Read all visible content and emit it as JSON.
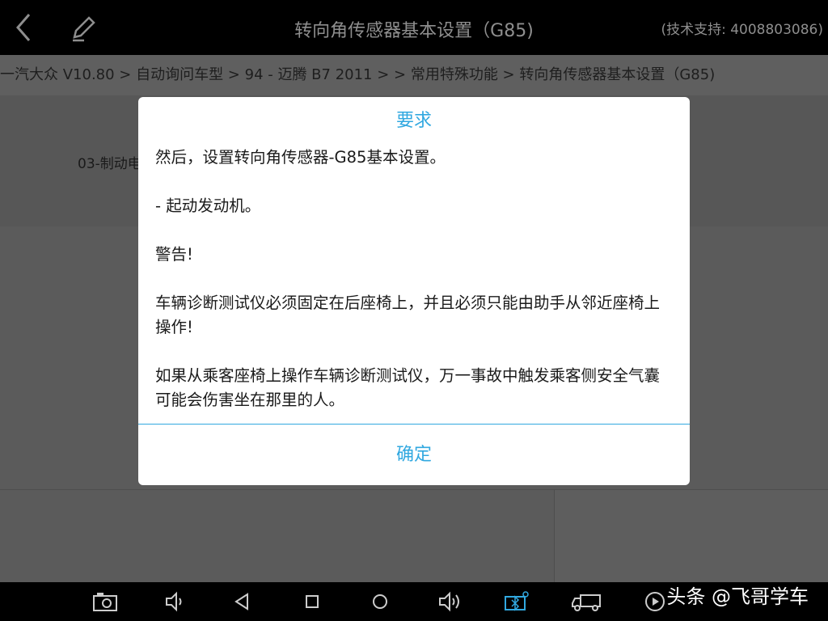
{
  "header": {
    "title": "转向角传感器基本设置（G85)",
    "support": "(技术支持: 4008803086)",
    "back_icon": "chevron-left-icon",
    "edit_icon": "pencil-icon"
  },
  "breadcrumb": "一汽大众 V10.80 > 自动询问车型 > 94 - 迈腾 B7 2011 > > 常用特殊功能 > 转向角传感器基本设置（G85)",
  "background": {
    "row_label": "03-制动电"
  },
  "dialog": {
    "title": "要求",
    "paragraphs": [
      "然后，设置转向角传感器-G85基本设置。",
      "- 起动发动机。",
      "警告!",
      "车辆诊断测试仪必须固定在后座椅上，并且必须只能由助手从邻近座椅上操作!",
      "如果从乘客座椅上操作车辆诊断测试仪，万一事故中触发乘客侧安全气囊可能会伤害坐在那里的人。"
    ],
    "ok_label": "确定",
    "accent_color": "#31a8e0"
  },
  "navbar": {
    "icons": [
      "camera-icon",
      "volume-down-icon",
      "back-triangle-icon",
      "home-square-icon",
      "home-circle-icon",
      "volume-up-icon",
      "bluetooth-device-icon",
      "truck-icon",
      "play-icon"
    ]
  },
  "watermark": "头条 @飞哥学车"
}
